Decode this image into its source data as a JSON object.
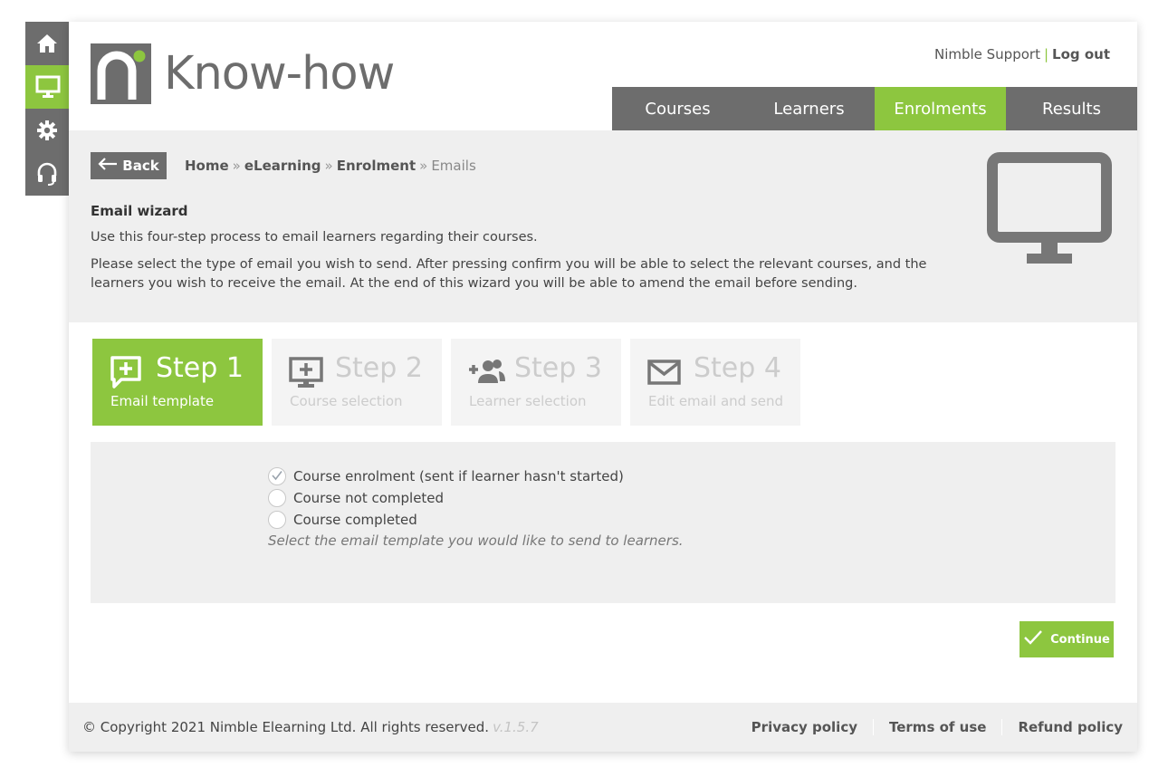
{
  "brand": {
    "name": "Know-how",
    "accent_color": "#8dc63f",
    "dark_color": "#6d6d6d"
  },
  "rail": {
    "items": [
      {
        "icon": "home-icon",
        "active": false
      },
      {
        "icon": "monitor-icon",
        "active": true
      },
      {
        "icon": "gear-icon",
        "active": false
      },
      {
        "icon": "headset-icon",
        "active": false
      }
    ]
  },
  "header": {
    "user_name": "Nimble Support",
    "separator": "|",
    "logout_label": "Log out"
  },
  "nav": {
    "items": [
      {
        "label": "Courses"
      },
      {
        "label": "Learners"
      },
      {
        "label": "Enrolments",
        "active": true
      },
      {
        "label": "Results"
      }
    ]
  },
  "breadcrumb": {
    "back_label": "Back",
    "items": [
      "Home",
      "eLearning",
      "Enrolment"
    ],
    "current": "Emails",
    "separator": "»"
  },
  "intro": {
    "title": "Email wizard",
    "para1": "Use this four-step process to email learners regarding their courses.",
    "para2": "Please select the type of email you wish to send. After pressing confirm you will be able to select the relevant courses, and the learners you wish to receive the email. At the end of this wizard you will be able to amend the email before sending."
  },
  "steps": [
    {
      "title": "Step 1",
      "subtitle": "Email template",
      "icon": "message-plus-icon",
      "active": true
    },
    {
      "title": "Step 2",
      "subtitle": "Course selection",
      "icon": "monitor-plus-icon",
      "active": false
    },
    {
      "title": "Step 3",
      "subtitle": "Learner selection",
      "icon": "add-users-icon",
      "active": false
    },
    {
      "title": "Step 4",
      "subtitle": "Edit email and send",
      "icon": "envelope-icon",
      "active": false
    }
  ],
  "templates": {
    "options": [
      {
        "label": "Course enrolment (sent if learner hasn't started)",
        "selected": true
      },
      {
        "label": "Course not completed",
        "selected": false
      },
      {
        "label": "Course completed",
        "selected": false
      }
    ],
    "help_text": "Select the email template you would like to send to learners."
  },
  "actions": {
    "continue_label": "Continue"
  },
  "footer": {
    "copyright": "© Copyright 2021 Nimble Elearning Ltd. All rights reserved.",
    "version": "v.1.5.7",
    "links": [
      "Privacy policy",
      "Terms of use",
      "Refund policy"
    ]
  }
}
